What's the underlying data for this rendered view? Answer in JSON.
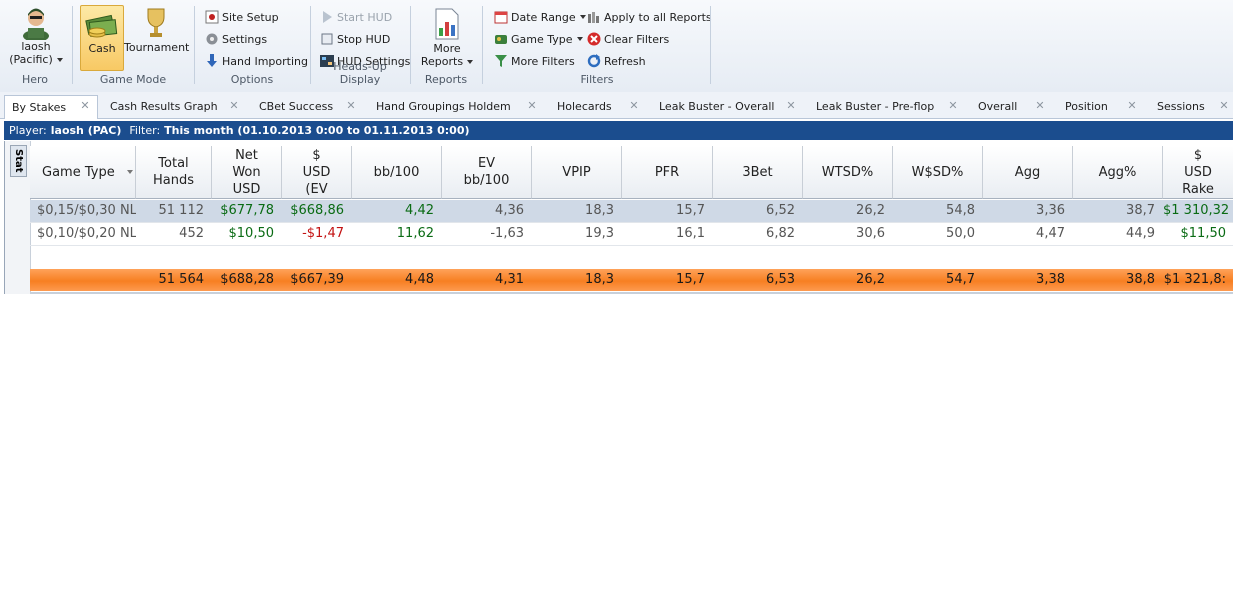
{
  "ribbon": {
    "hero": {
      "name": "laosh",
      "site": "(Pacific)",
      "group_label": "Hero"
    },
    "game_mode": {
      "cash_label": "Cash",
      "tournament_label": "Tournament",
      "group_label": "Game Mode"
    },
    "options": {
      "site_setup": "Site Setup",
      "settings": "Settings",
      "hand_importing": "Hand Importing",
      "group_label": "Options"
    },
    "hud": {
      "start_hud": "Start HUD",
      "stop_hud": "Stop HUD",
      "hud_settings": "HUD Settings",
      "group_label": "Heads-Up Display"
    },
    "reports": {
      "more_reports_line1": "More",
      "more_reports_line2": "Reports",
      "group_label": "Reports"
    },
    "filters": {
      "date_range": "Date Range",
      "game_type": "Game Type",
      "more_filters": "More Filters",
      "apply_all": "Apply to all Reports",
      "clear_filters": "Clear Filters",
      "refresh": "Refresh",
      "group_label": "Filters"
    }
  },
  "tabs": [
    "By Stakes",
    "Cash Results Graph",
    "CBet Success",
    "Hand Groupings Holdem",
    "Holecards",
    "Leak Buster - Overall",
    "Leak Buster - Pre-flop",
    "Overall",
    "Position",
    "Sessions"
  ],
  "filterbar": {
    "player_label": "Player:",
    "player_value": "laosh (PAC)",
    "filter_label": "Filter:",
    "filter_value": "This month (01.10.2013 0:00 to 01.11.2013 0:00)"
  },
  "sidetab_label": "Stat",
  "columns": [
    [
      "Game Type"
    ],
    [
      "Total",
      "Hands"
    ],
    [
      "Net",
      "Won",
      "USD"
    ],
    [
      "$",
      "USD",
      "(EV"
    ],
    [
      "bb/100"
    ],
    [
      "EV",
      "bb/100"
    ],
    [
      "VPIP"
    ],
    [
      "PFR"
    ],
    [
      "3Bet"
    ],
    [
      "WTSD%"
    ],
    [
      "W$SD%"
    ],
    [
      "Agg"
    ],
    [
      "Agg%"
    ],
    [
      "$",
      "USD",
      "Rake"
    ]
  ],
  "rows": [
    [
      "$0,15/$0,30 NL",
      "51 112",
      "$677,78",
      "$668,86",
      "4,42",
      "4,36",
      "18,3",
      "15,7",
      "6,52",
      "26,2",
      "54,8",
      "3,36",
      "38,7",
      "$1 310,32"
    ],
    [
      "$0,10/$0,20 NL",
      "452",
      "$10,50",
      "-$1,47",
      "11,62",
      "-1,63",
      "19,3",
      "16,1",
      "6,82",
      "30,6",
      "50,0",
      "4,47",
      "44,9",
      "$11,50"
    ]
  ],
  "totals": [
    "",
    "51 564",
    "$688,28",
    "$667,39",
    "4,48",
    "4,31",
    "18,3",
    "15,7",
    "6,53",
    "26,2",
    "54,7",
    "3,38",
    "38,8",
    "$1 321,8:"
  ],
  "colors": {
    "positive": "#0a6b14",
    "negative": "#c31212",
    "filterbar": "#1b4d8e",
    "total_row": "#f77f22",
    "selected_row": "#cfd9e6"
  }
}
